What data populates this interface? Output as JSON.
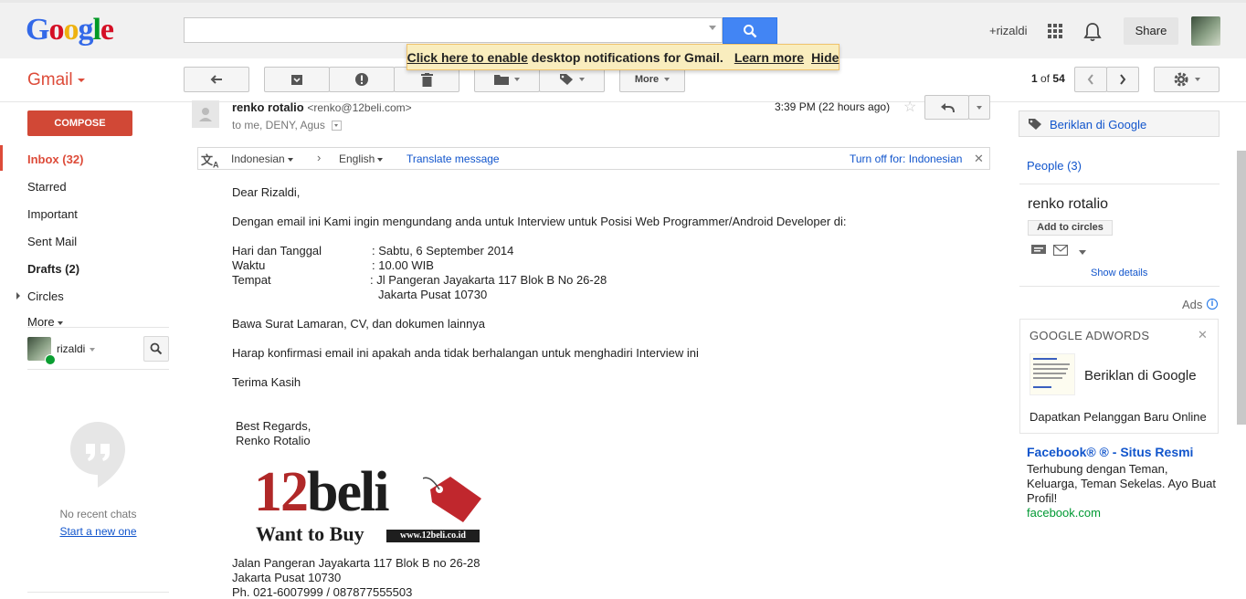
{
  "header": {
    "logo_text": "Google",
    "search": {
      "value": "",
      "placeholder": ""
    },
    "user": "+rizaldi",
    "share_label": "Share"
  },
  "notification": {
    "enable_link": "Click here to enable",
    "text": " desktop notifications for Gmail.",
    "learn_more": "Learn more",
    "hide": "Hide"
  },
  "gmail": {
    "label": "Gmail"
  },
  "toolbar": {
    "more_label": "More"
  },
  "pager": {
    "current": "1",
    "of": "of",
    "total": "54"
  },
  "sidebar": {
    "compose": "COMPOSE",
    "items": [
      {
        "label": "Inbox (32)"
      },
      {
        "label": "Starred"
      },
      {
        "label": "Important"
      },
      {
        "label": "Sent Mail"
      },
      {
        "label": "Drafts (2)"
      },
      {
        "label": "Circles"
      },
      {
        "label": "More"
      }
    ],
    "chat_user": "rizaldi",
    "no_chats": "No recent chats",
    "start_new": "Start a new one"
  },
  "message": {
    "sender_name": "renko rotalio",
    "sender_email": "<renko@12beli.com>",
    "recipients": "to me, DENY, Agus",
    "time": "3:39 PM (22 hours ago)",
    "translate": {
      "from": "Indonesian",
      "to": "English",
      "action": "Translate message",
      "turn_off": "Turn off for: Indonesian"
    },
    "body": {
      "greeting": "Dear Rizaldi,",
      "intro": "Dengan email ini Kami ingin mengundang anda untuk Interview untuk Posisi Web Programmer/Android Developer di:",
      "date_label": "Hari dan Tanggal",
      "date_value": ": Sabtu, 6 September 2014",
      "time_label": "Waktu",
      "time_value": ": 10.00 WIB",
      "place_label": "Tempat",
      "place_value": ": Jl Pangeran Jayakarta 117 Blok B No 26-28",
      "place_value2": "Jakarta Pusat 10730",
      "bring": "Bawa Surat Lamaran, CV, dan dokumen lainnya",
      "confirm": "Harap konfirmasi email ini apakah anda tidak berhalangan untuk menghadiri Interview ini",
      "thanks": "Terima Kasih",
      "regards": "Best Regards,",
      "signature_name": "Renko Rotalio",
      "logo_main": "12beli",
      "logo_tagline": "Want to Buy",
      "logo_url": "www.12beli.co.id",
      "address1": "Jalan Pangeran Jayakarta 117 Blok B no 26-28",
      "address2": "Jakarta Pusat 10730",
      "phone": "Ph. 021-6007999 / 087877555503"
    }
  },
  "right_panel": {
    "ad_button": "Beriklan di Google",
    "people": "People (3)",
    "contact_name": "renko rotalio",
    "add_to_circles": "Add to circles",
    "show_details": "Show details",
    "ads_label": "Ads",
    "adwords": {
      "title": "GOOGLE ADWORDS",
      "headline": "Beriklan di Google",
      "description": "Dapatkan Pelanggan Baru Online"
    },
    "fb_ad": {
      "title": "Facebook® ® - Situs Resmi",
      "text1": "Terhubung dengan Teman,",
      "text2": "Keluarga, Teman Sekelas. Ayo Buat",
      "text3": "Profil!",
      "url": "facebook.com"
    }
  },
  "colors": {
    "accent": "#dd4b39",
    "link": "#1155cc",
    "search_blue": "#4285f4",
    "green_url": "#009933"
  }
}
